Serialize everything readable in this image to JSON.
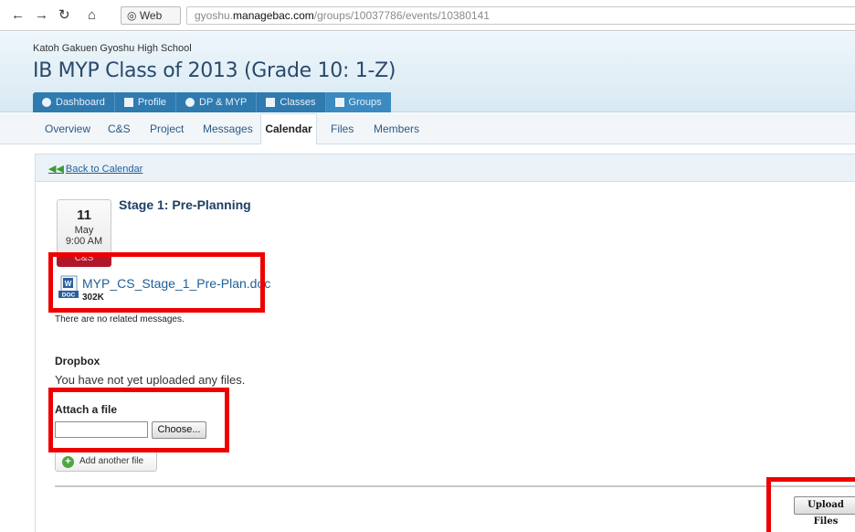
{
  "browser": {
    "back_icon": "←",
    "forward_icon": "→",
    "reload_icon": "↻",
    "home_icon": "⌂",
    "tab_label": "Web",
    "url_prefix": "gyoshu.",
    "url_domain": "managebac.com",
    "url_path": "/groups/10037786/events/10380141"
  },
  "header": {
    "school": "Katoh Gakuen Gyoshu High School",
    "title": "IB MYP Class of 2013 (Grade 10: 1-Z)"
  },
  "main_nav": [
    {
      "label": "Dashboard",
      "icon": "info-icon"
    },
    {
      "label": "Profile",
      "icon": "profile-card-icon"
    },
    {
      "label": "DP & MYP",
      "icon": "globe-icon"
    },
    {
      "label": "Classes",
      "icon": "books-icon"
    },
    {
      "label": "Groups",
      "icon": "trophy-icon"
    }
  ],
  "sub_nav": {
    "overview": "Overview",
    "cs": "C&S",
    "project": "Project",
    "messages": "Messages",
    "calendar": "Calendar",
    "files": "Files",
    "members": "Members"
  },
  "event": {
    "back_arrows": "◀◀",
    "back_label": "Back to Calendar",
    "day": "11",
    "month": "May",
    "time": "9:00 AM",
    "category": "C&S",
    "title": "Stage 1: Pre-Planning",
    "attachment_name": "MYP_CS_Stage_1_Pre-Plan.doc",
    "attachment_size": "302K",
    "doc_badge": "DOC",
    "no_messages": "There are no related messages."
  },
  "dropbox": {
    "heading": "Dropbox",
    "status": "You have not yet uploaded any files.",
    "attach_heading": "Attach a file",
    "choose_label": "Choose...",
    "add_another_label": "Add another file",
    "upload_label": "Upload Files"
  },
  "colors": {
    "annotation_red": "#ee0000",
    "nav_blue": "#2f7bb0",
    "category_red": "#b0182a",
    "link_blue": "#1f5f99"
  }
}
